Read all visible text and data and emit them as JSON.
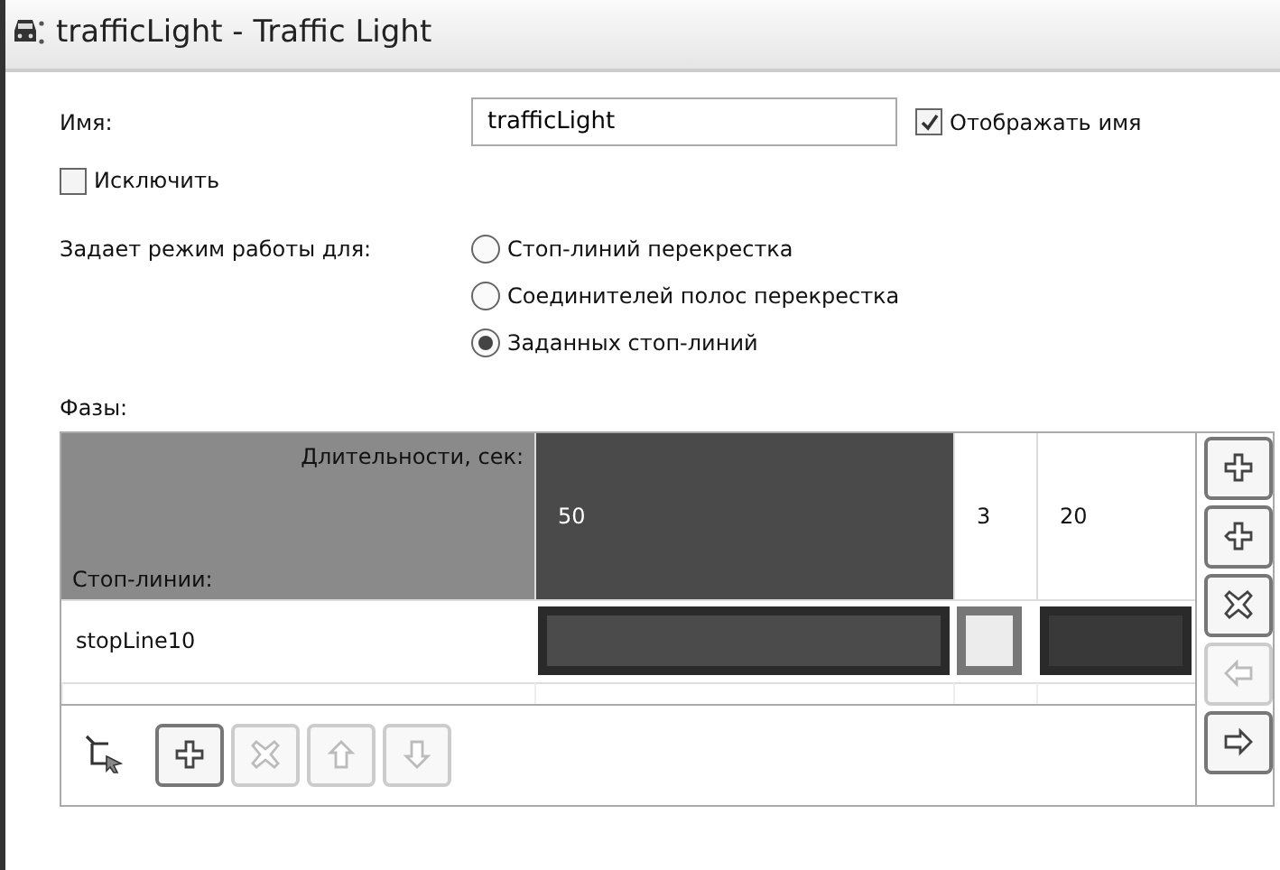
{
  "title": "trafficLight - Traffic Light",
  "name_field": {
    "label": "Имя:",
    "value": "trafficLight"
  },
  "show_name": {
    "label": "Отображать имя",
    "checked": true
  },
  "exclude": {
    "label": "Исключить",
    "checked": false
  },
  "mode": {
    "label": "Задает режим работы для:",
    "options": [
      {
        "label": "Стоп-линий перекрестка",
        "selected": false
      },
      {
        "label": "Соединителей полос перекрестка",
        "selected": false
      },
      {
        "label": "Заданных стоп-линий",
        "selected": true
      }
    ]
  },
  "phases": {
    "label": "Фазы:",
    "durations_header": "Длительности, сек:",
    "stoplines_header": "Стоп-линии:",
    "columns": [
      {
        "duration": "50",
        "selected": true
      },
      {
        "duration": "3",
        "selected": false
      },
      {
        "duration": "20",
        "selected": false
      }
    ],
    "rows": [
      {
        "name": "stopLine10",
        "cells": [
          {
            "color": "#4b4b4b"
          },
          {
            "color": "#ececec"
          },
          {
            "color": "#393939"
          }
        ]
      }
    ],
    "side_buttons": [
      {
        "kind": "add",
        "disabled": false
      },
      {
        "kind": "insert",
        "disabled": false
      },
      {
        "kind": "delete",
        "disabled": false
      },
      {
        "kind": "left",
        "disabled": true
      },
      {
        "kind": "right",
        "disabled": false
      }
    ],
    "bottom_buttons": [
      {
        "kind": "add",
        "disabled": false
      },
      {
        "kind": "delete",
        "disabled": true
      },
      {
        "kind": "up",
        "disabled": true
      },
      {
        "kind": "down",
        "disabled": true
      }
    ]
  }
}
